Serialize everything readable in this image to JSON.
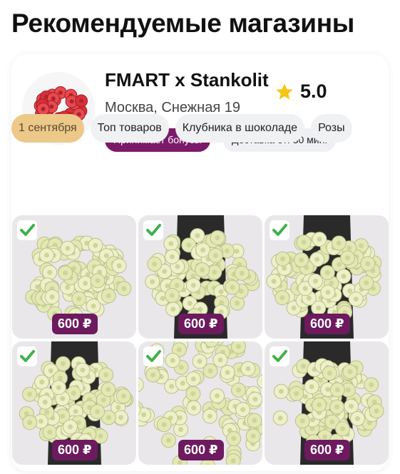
{
  "section": {
    "title": "Рекомендуемые магазины"
  },
  "shop": {
    "name": "FMART x Stankolit",
    "rating": "5.0",
    "address": "Москва, Снежная 19",
    "bonus_badge": "Принимает бонусы",
    "delivery_badge": "Доставка от: 30 мин.",
    "avatar_icon": "red-roses-bouquet"
  },
  "categories": [
    {
      "label": "1 сентября",
      "active": true
    },
    {
      "label": "Топ товаров",
      "active": false
    },
    {
      "label": "Клубника в шоколаде",
      "active": false
    },
    {
      "label": "Розы",
      "active": false
    }
  ],
  "products": [
    {
      "price": "600 ₽",
      "checked": true,
      "image": "white-roses-bouquet"
    },
    {
      "price": "600 ₽",
      "checked": true,
      "image": "white-roses-bouquet"
    },
    {
      "price": "600 ₽",
      "checked": true,
      "image": "white-roses-bouquet"
    },
    {
      "price": "600 ₽",
      "checked": true,
      "image": "white-roses-bouquet"
    },
    {
      "price": "600 ₽",
      "checked": true,
      "image": "white-roses-bouquet"
    },
    {
      "price": "600 ₽",
      "checked": true,
      "image": "white-roses-bouquet"
    }
  ],
  "colors": {
    "bonus_badge": "#7c1a6a",
    "price_badge": "#6d1a5e",
    "active_chip": "#ecc989",
    "check_green": "#3fb14b",
    "star": "#f5c518"
  }
}
